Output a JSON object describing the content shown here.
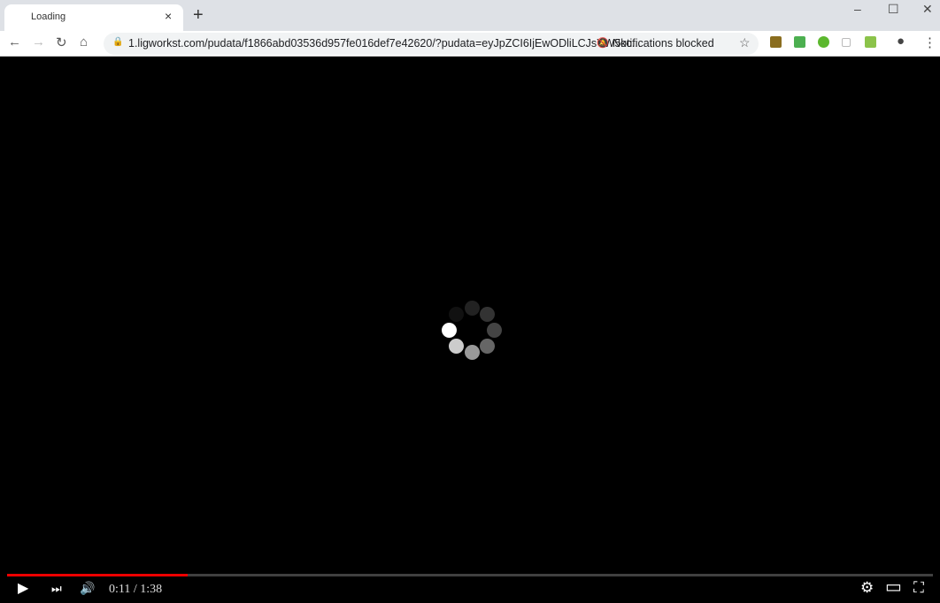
{
  "browser": {
    "tab": {
      "title": "Loading",
      "close": "×"
    },
    "new_tab": "+",
    "window_controls": {
      "minimize": "–",
      "maximize": "☐",
      "close": "✕"
    },
    "nav": {
      "back": "←",
      "forward": "→",
      "reload": "↻",
      "home": "⌂"
    },
    "url": "1.ligworkst.com/pudata/f1866abd03536d957fe016def7e42620/?pudata=eyJpZCI6IjEwODliLCJsYW5kc...",
    "notifications": "Notifications blocked",
    "bookmark": "☆",
    "extensions": [
      {
        "name": "cc-extension",
        "color": "#8a6d1f"
      },
      {
        "name": "green-extension",
        "color": "#4caf50"
      },
      {
        "name": "green-circle-extension",
        "color": "#5cb82e"
      },
      {
        "name": "robot-extension",
        "color": "#bbbbbb"
      },
      {
        "name": "yellow-extension",
        "color": "#8bc34a"
      }
    ],
    "profile": "●",
    "menu": "⋮"
  },
  "player": {
    "time": "0:11 / 1:38",
    "progress_percent": 19.5,
    "accent": "#ee0000",
    "icons": {
      "play": "▶",
      "next": "⏭",
      "volume": "🔊",
      "settings": "⚙",
      "theater": "▭",
      "fullscreen": "⛶"
    }
  }
}
